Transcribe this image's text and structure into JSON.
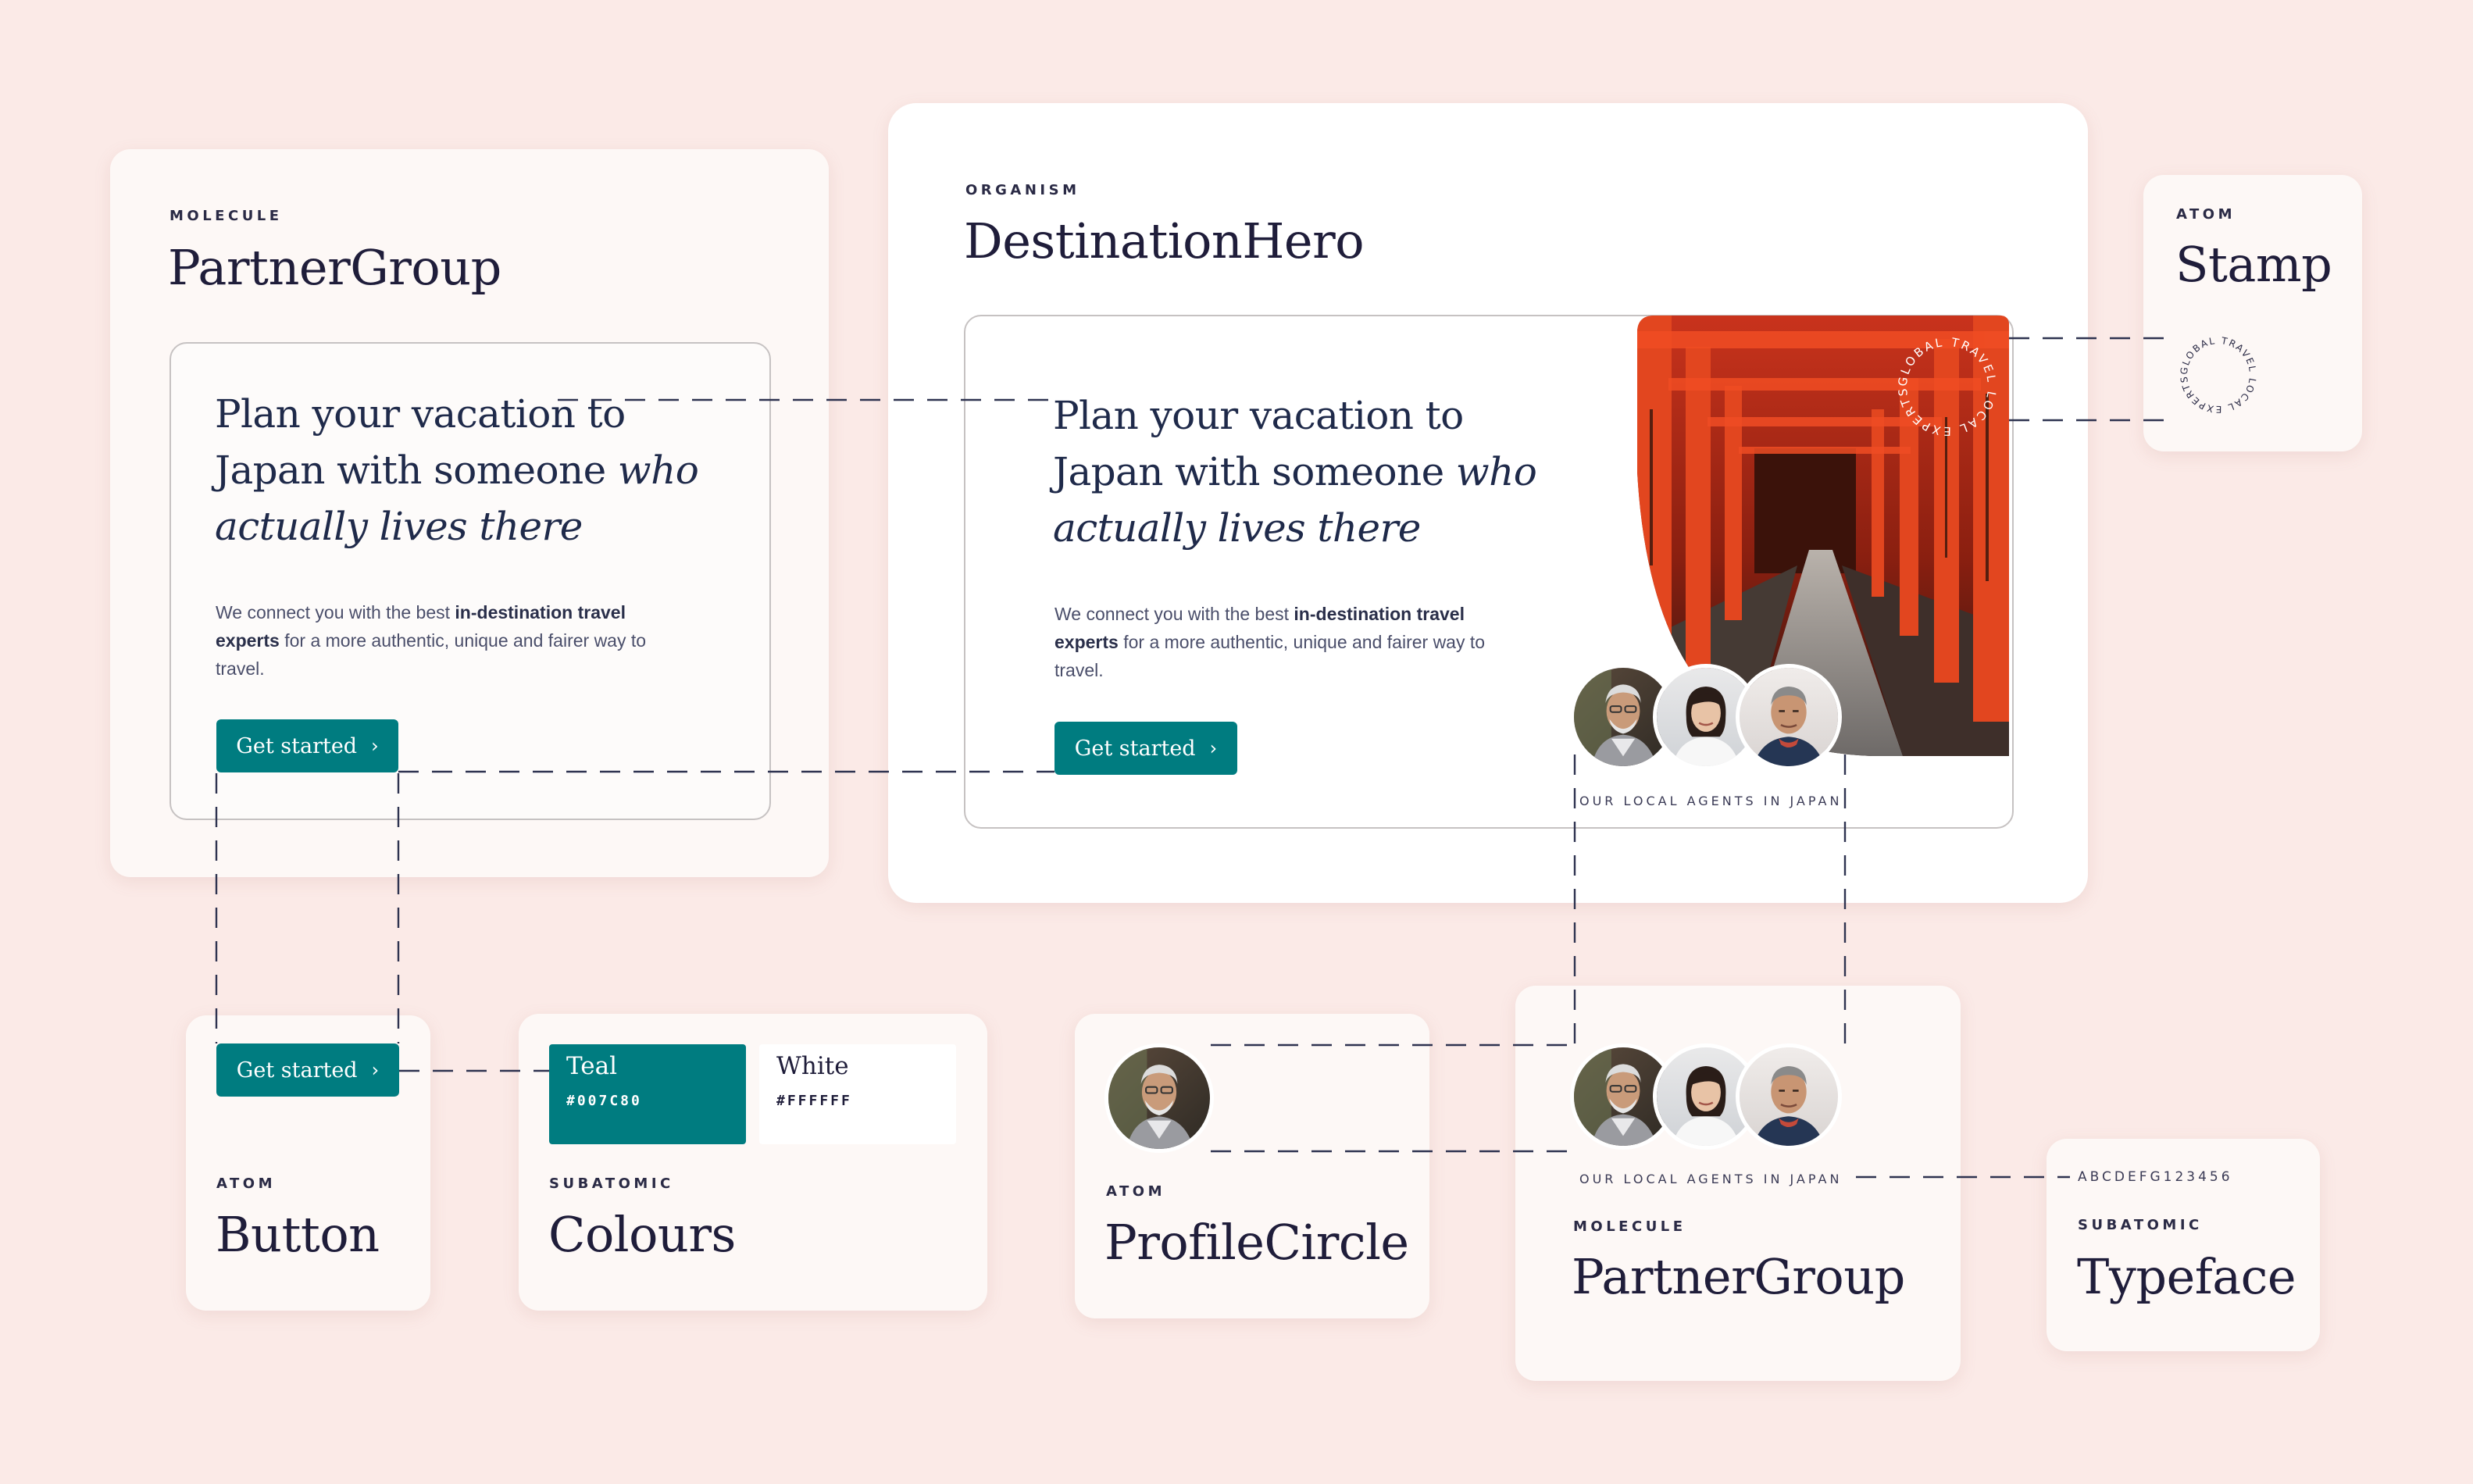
{
  "colors": {
    "background": "#fbeae7",
    "card": "#fdf8f6",
    "teal": "#007C80",
    "white": "#FFFFFF",
    "navy": "#1f1d3a",
    "torii": "#d4371c"
  },
  "partner_group_top": {
    "label": "MOLECULE",
    "title": "PartnerGroup",
    "headline_1": "Plan your vacation to",
    "headline_2": "Japan with someone ",
    "headline_2_em": "who",
    "headline_3_em": "actually lives there",
    "body_1": "We connect you with the best ",
    "body_bold_1": "in-destination travel",
    "body_bold_2": "experts",
    "body_2": " for a more authentic, unique and fairer way to",
    "body_3": "travel.",
    "button_label": "Get started",
    "button_chevron": "›"
  },
  "destination_hero": {
    "label": "ORGANISM",
    "title": "DestinationHero",
    "headline_1": "Plan your vacation to",
    "headline_2": "Japan with someone ",
    "headline_2_em": "who",
    "headline_3_em": "actually lives there",
    "body_1": "We connect you with the best ",
    "body_bold_1": "in-destination travel",
    "body_bold_2": "experts",
    "body_2": " for a more authentic, unique and fairer way to",
    "body_3": "travel.",
    "button_label": "Get started",
    "button_chevron": "›",
    "agents_caption": "OUR LOCAL AGENTS IN JAPAN",
    "stamp_text": "GLOBAL TRAVEL LOCAL EXPERTS"
  },
  "stamp": {
    "label": "ATOM",
    "title": "Stamp",
    "stamp_text": "GLOBAL TRAVEL LOCAL EXPERTS"
  },
  "button_atom": {
    "label": "ATOM",
    "title": "Button",
    "button_label": "Get started",
    "button_chevron": "›"
  },
  "colours": {
    "label": "SUBATOMIC",
    "title": "Colours",
    "swatches": [
      {
        "name": "Teal",
        "hex": "#007C80"
      },
      {
        "name": "White",
        "hex": "#FFFFFF"
      }
    ]
  },
  "profile_circle": {
    "label": "ATOM",
    "title": "ProfileCircle"
  },
  "partner_group_bottom": {
    "label": "MOLECULE",
    "title": "PartnerGroup",
    "agents_caption": "OUR LOCAL AGENTS IN JAPAN"
  },
  "typeface": {
    "label": "SUBATOMIC",
    "title": "Typeface",
    "sample": "ABCDEFG123456"
  },
  "icons": {
    "chevron": "chevron-right-icon",
    "stamp": "circular-stamp-icon"
  }
}
